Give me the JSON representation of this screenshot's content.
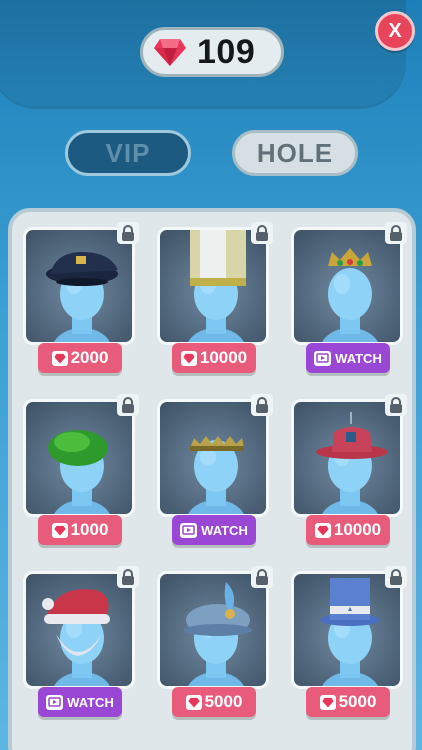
{
  "header": {
    "gem_count": "109",
    "close_label": "X"
  },
  "tabs": [
    {
      "label": "VIP",
      "active": true
    },
    {
      "label": "HOLE",
      "active": false
    }
  ],
  "items": [
    {
      "hat": "police-cap",
      "price": "2000",
      "type": "gem"
    },
    {
      "hat": "tall-hat",
      "price": "10000",
      "type": "gem"
    },
    {
      "hat": "crown",
      "price": "WATCH",
      "type": "watch"
    },
    {
      "hat": "green-beret",
      "price": "1000",
      "type": "gem"
    },
    {
      "hat": "gold-tiara",
      "price": "WATCH",
      "type": "watch"
    },
    {
      "hat": "red-fire-hat",
      "price": "10000",
      "type": "gem"
    },
    {
      "hat": "santa-hat",
      "price": "WATCH",
      "type": "watch"
    },
    {
      "hat": "genie-turban",
      "price": "5000",
      "type": "gem"
    },
    {
      "hat": "blue-top-hat",
      "price": "5000",
      "type": "gem"
    }
  ],
  "colors": {
    "gem": "#e8365a",
    "price_gem_bg": "#e85b7b",
    "price_watch_bg": "#9a47d6",
    "avatar": "#7cc6f2"
  }
}
